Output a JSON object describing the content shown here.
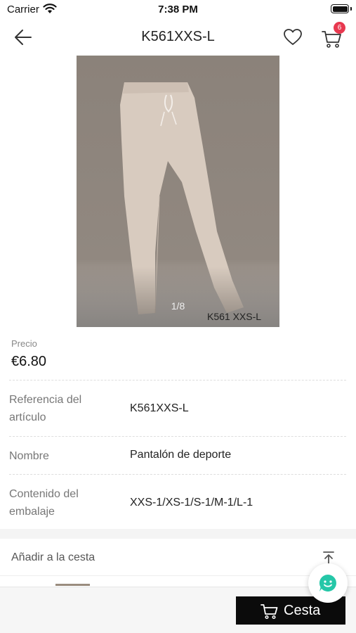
{
  "status_bar": {
    "carrier": "Carrier",
    "time": "7:38 PM",
    "icons": [
      "wifi-icon",
      "battery-icon"
    ]
  },
  "nav": {
    "title": "K561XXS-L",
    "cart_count": "6",
    "icons": [
      "back-arrow-icon",
      "heart-icon",
      "cart-icon"
    ],
    "badge_color": "#e8384f"
  },
  "gallery": {
    "counter": "1/8",
    "caption": "K561 XXS-L"
  },
  "price": {
    "label": "Precio",
    "value": "€6.80"
  },
  "attributes": [
    {
      "label": "Referencia del artículo",
      "value": "K561XXS-L"
    },
    {
      "label": "Nombre",
      "value": "Pantalón de deporte"
    },
    {
      "label": "Contenido del embalaje",
      "value": "XXS-1/XS-1/S-1/M-1/L-1"
    }
  ],
  "add_to_cart": {
    "label": "Añadir a la cesta",
    "icon": "scroll-to-top-icon"
  },
  "bottom_bar": {
    "cesta_label": "Cesta",
    "cesta_icon": "cart-icon",
    "chat_icon": "chat-smile-icon",
    "chat_color": "#25c7a8"
  }
}
